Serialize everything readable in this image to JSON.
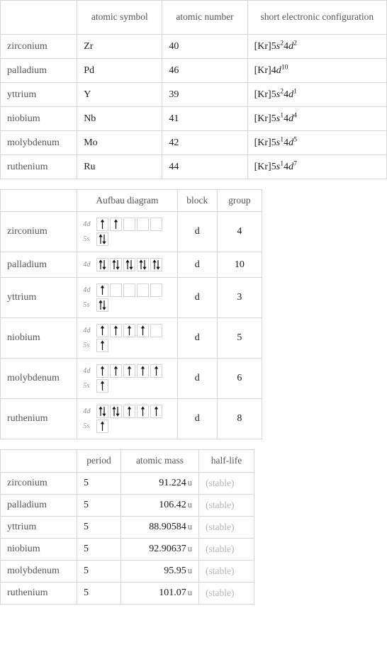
{
  "elements": [
    "zirconium",
    "palladium",
    "yttrium",
    "niobium",
    "molybdenum",
    "ruthenium"
  ],
  "table_properties": {
    "headers": [
      "",
      "atomic symbol",
      "atomic number",
      "short electronic configuration"
    ],
    "rows": [
      {
        "name": "zirconium",
        "symbol": "Zr",
        "atomic_number": "40",
        "config_text": "[Kr]5s24d2",
        "config_parts": [
          {
            "text": "[Kr]5",
            "style": "plain"
          },
          {
            "text": "s",
            "style": "italic"
          },
          {
            "text": "2",
            "style": "sup"
          },
          {
            "text": "4",
            "style": "plain"
          },
          {
            "text": "d",
            "style": "italic"
          },
          {
            "text": "2",
            "style": "sup"
          }
        ]
      },
      {
        "name": "palladium",
        "symbol": "Pd",
        "atomic_number": "46",
        "config_text": "[Kr]4d10",
        "config_parts": [
          {
            "text": "[Kr]4",
            "style": "plain"
          },
          {
            "text": "d",
            "style": "italic"
          },
          {
            "text": "10",
            "style": "sup"
          }
        ]
      },
      {
        "name": "yttrium",
        "symbol": "Y",
        "atomic_number": "39",
        "config_text": "[Kr]5s24d1",
        "config_parts": [
          {
            "text": "[Kr]5",
            "style": "plain"
          },
          {
            "text": "s",
            "style": "italic"
          },
          {
            "text": "2",
            "style": "sup"
          },
          {
            "text": "4",
            "style": "plain"
          },
          {
            "text": "d",
            "style": "italic"
          },
          {
            "text": "1",
            "style": "sup"
          }
        ]
      },
      {
        "name": "niobium",
        "symbol": "Nb",
        "atomic_number": "41",
        "config_text": "[Kr]5s14d4",
        "config_parts": [
          {
            "text": "[Kr]5",
            "style": "plain"
          },
          {
            "text": "s",
            "style": "italic"
          },
          {
            "text": "1",
            "style": "sup"
          },
          {
            "text": "4",
            "style": "plain"
          },
          {
            "text": "d",
            "style": "italic"
          },
          {
            "text": "4",
            "style": "sup"
          }
        ]
      },
      {
        "name": "molybdenum",
        "symbol": "Mo",
        "atomic_number": "42",
        "config_text": "[Kr]5s14d5",
        "config_parts": [
          {
            "text": "[Kr]5",
            "style": "plain"
          },
          {
            "text": "s",
            "style": "italic"
          },
          {
            "text": "1",
            "style": "sup"
          },
          {
            "text": "4",
            "style": "plain"
          },
          {
            "text": "d",
            "style": "italic"
          },
          {
            "text": "5",
            "style": "sup"
          }
        ]
      },
      {
        "name": "ruthenium",
        "symbol": "Ru",
        "atomic_number": "44",
        "config_text": "[Kr]5s14d7",
        "config_parts": [
          {
            "text": "[Kr]5",
            "style": "plain"
          },
          {
            "text": "s",
            "style": "italic"
          },
          {
            "text": "1",
            "style": "sup"
          },
          {
            "text": "4",
            "style": "plain"
          },
          {
            "text": "d",
            "style": "italic"
          },
          {
            "text": "7",
            "style": "sup"
          }
        ]
      }
    ]
  },
  "table_aufbau": {
    "headers": [
      "",
      "Aufbau diagram",
      "block",
      "group"
    ],
    "rows": [
      {
        "name": "zirconium",
        "block": "d",
        "group": "4",
        "orbitals": [
          {
            "label": "4d",
            "boxes": [
              "up",
              "up",
              "empty",
              "empty",
              "empty"
            ]
          },
          {
            "label": "5s",
            "boxes": [
              "updown"
            ]
          }
        ]
      },
      {
        "name": "palladium",
        "block": "d",
        "group": "10",
        "orbitals": [
          {
            "label": "4d",
            "boxes": [
              "updown",
              "updown",
              "updown",
              "updown",
              "updown"
            ]
          }
        ]
      },
      {
        "name": "yttrium",
        "block": "d",
        "group": "3",
        "orbitals": [
          {
            "label": "4d",
            "boxes": [
              "up",
              "empty",
              "empty",
              "empty",
              "empty"
            ]
          },
          {
            "label": "5s",
            "boxes": [
              "updown"
            ]
          }
        ]
      },
      {
        "name": "niobium",
        "block": "d",
        "group": "5",
        "orbitals": [
          {
            "label": "4d",
            "boxes": [
              "up",
              "up",
              "up",
              "up",
              "empty"
            ]
          },
          {
            "label": "5s",
            "boxes": [
              "up"
            ]
          }
        ]
      },
      {
        "name": "molybdenum",
        "block": "d",
        "group": "6",
        "orbitals": [
          {
            "label": "4d",
            "boxes": [
              "up",
              "up",
              "up",
              "up",
              "up"
            ]
          },
          {
            "label": "5s",
            "boxes": [
              "up"
            ]
          }
        ]
      },
      {
        "name": "ruthenium",
        "block": "d",
        "group": "8",
        "orbitals": [
          {
            "label": "4d",
            "boxes": [
              "updown",
              "updown",
              "up",
              "up",
              "up"
            ]
          },
          {
            "label": "5s",
            "boxes": [
              "up"
            ]
          }
        ]
      }
    ]
  },
  "table_facts": {
    "headers": [
      "",
      "period",
      "atomic mass",
      "half-life"
    ],
    "rows": [
      {
        "name": "zirconium",
        "period": "5",
        "mass": "91.224",
        "unit": "u",
        "half_life": "(stable)"
      },
      {
        "name": "palladium",
        "period": "5",
        "mass": "106.42",
        "unit": "u",
        "half_life": "(stable)"
      },
      {
        "name": "yttrium",
        "period": "5",
        "mass": "88.90584",
        "unit": "u",
        "half_life": "(stable)"
      },
      {
        "name": "niobium",
        "period": "5",
        "mass": "92.90637",
        "unit": "u",
        "half_life": "(stable)"
      },
      {
        "name": "molybdenum",
        "period": "5",
        "mass": "95.95",
        "unit": "u",
        "half_life": "(stable)"
      },
      {
        "name": "ruthenium",
        "period": "5",
        "mass": "101.07",
        "unit": "u",
        "half_life": "(stable)"
      }
    ]
  },
  "colors": {
    "border": "#d6d6d6",
    "box_border": "#d2d2d2",
    "text": "#1a1a1a",
    "label_text": "#555555",
    "muted_text": "#b4b4b4",
    "orbital_label": "#8a8a8a",
    "arrow": "#111111"
  }
}
